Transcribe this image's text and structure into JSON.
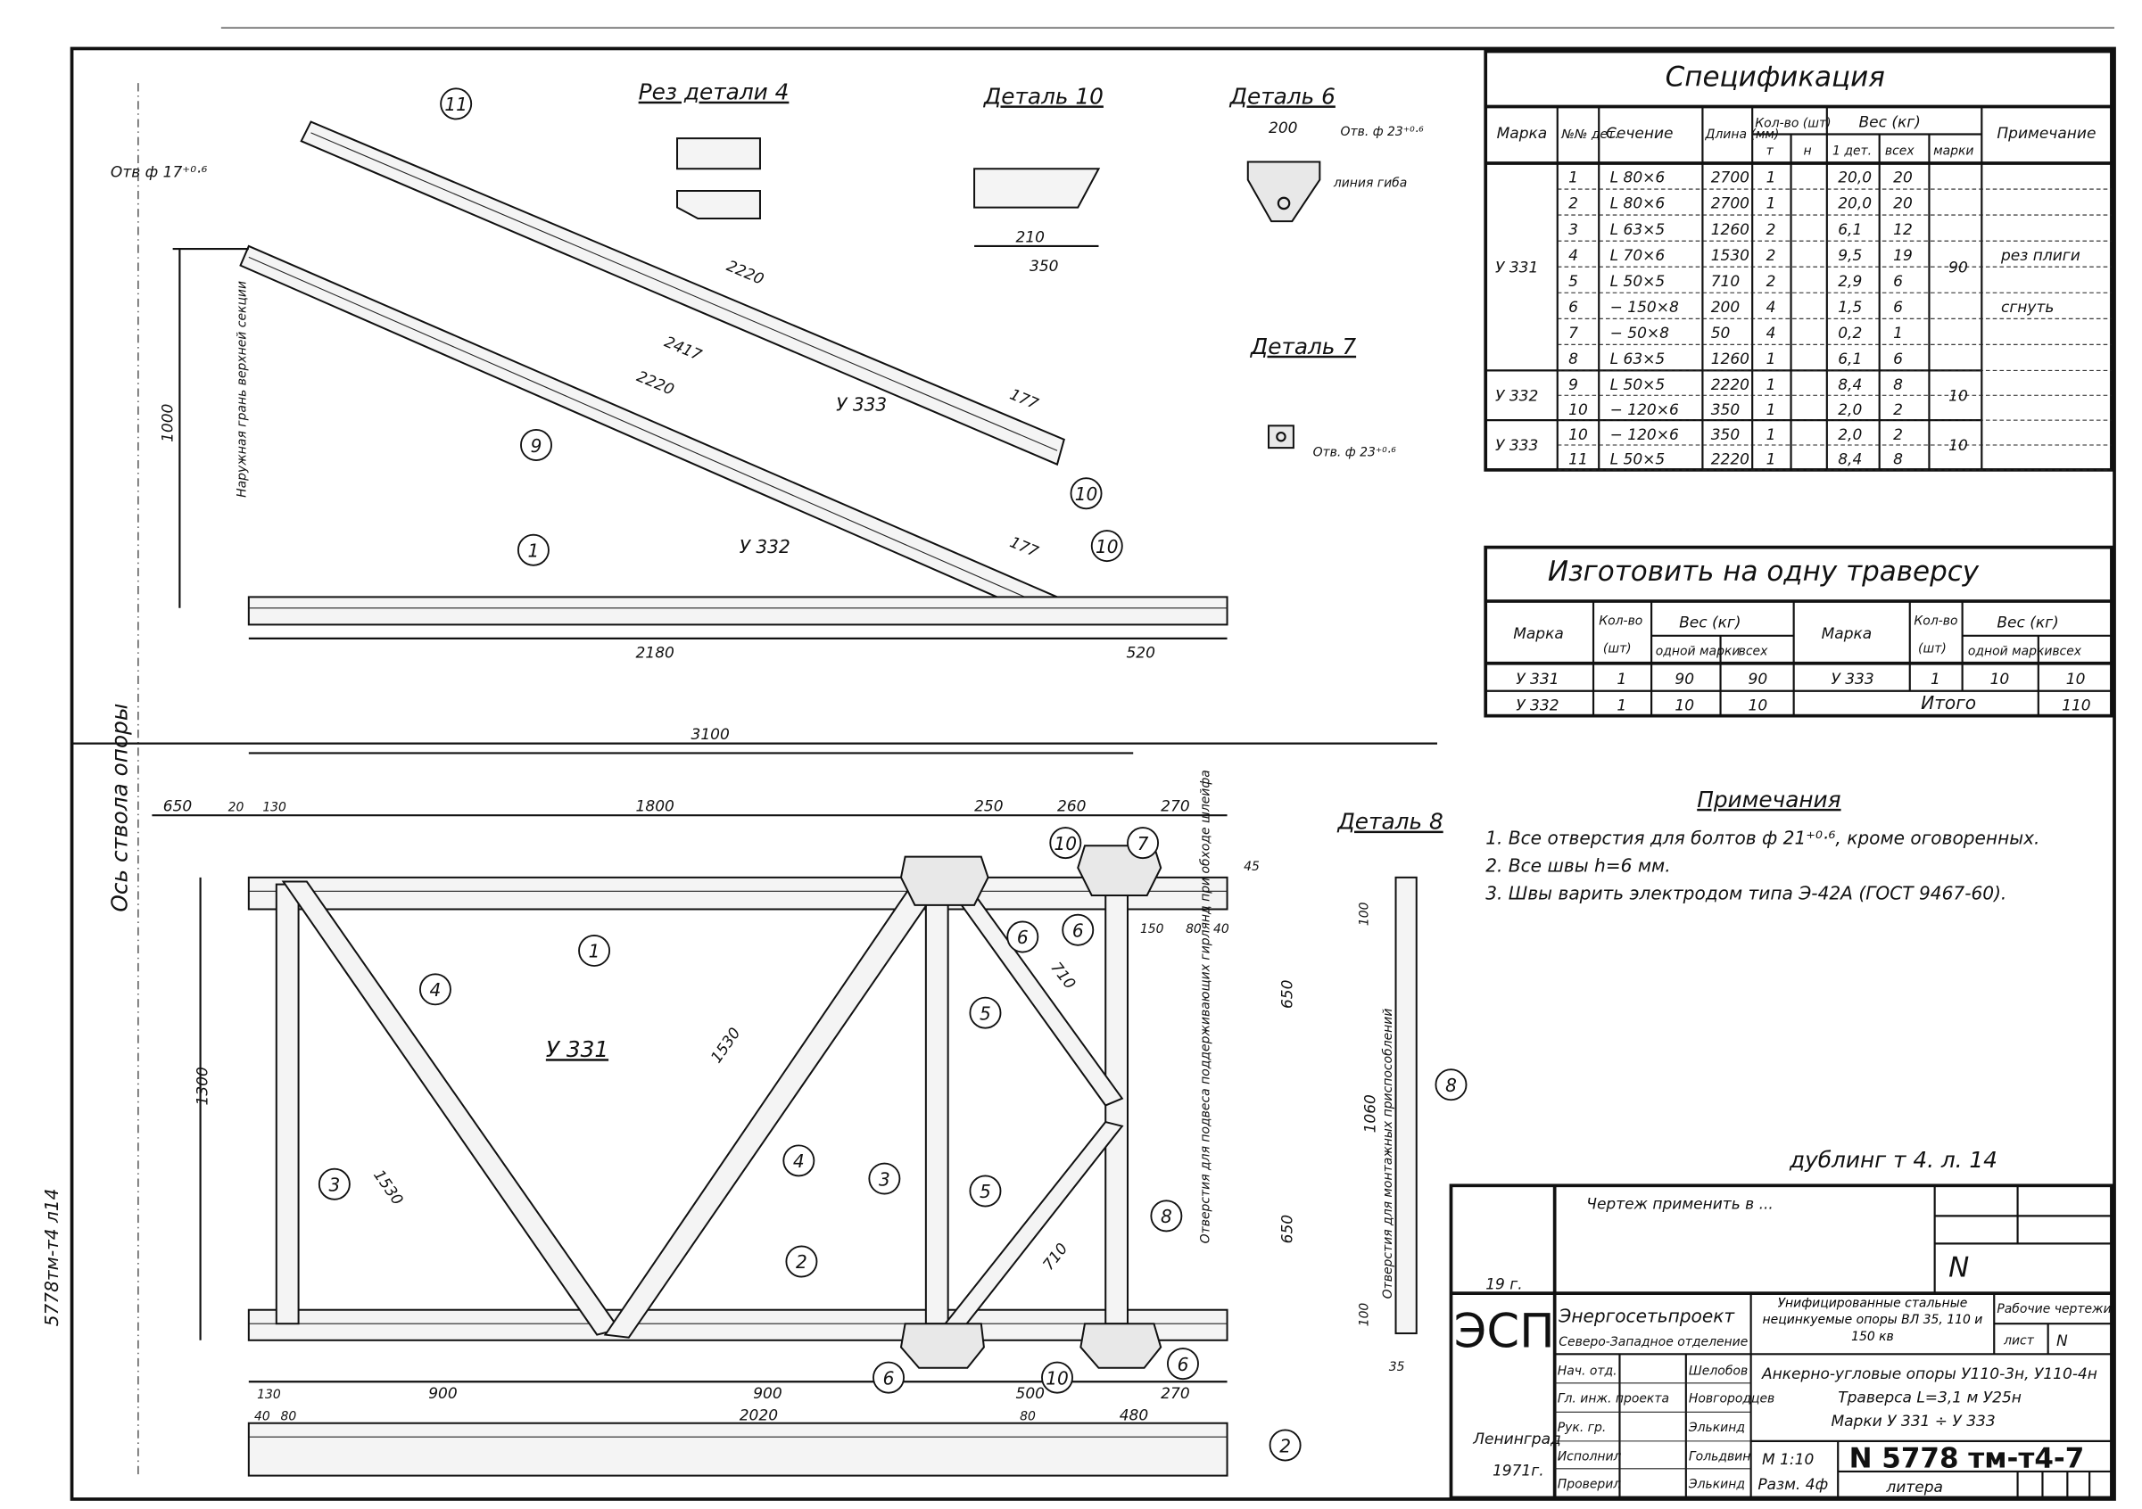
{
  "spec": {
    "title": "Спецификация",
    "headers": {
      "mark": "Марка",
      "part_no": "№№ дет.",
      "section": "Сечение",
      "length": "Длина (мм)",
      "qty": "Кол-во (шт)",
      "qty_t": "т",
      "qty_n": "н",
      "weight": "Вес (кг)",
      "w_part": "1 дет.",
      "w_all": "всех",
      "w_mark": "марки",
      "note": "Примечание"
    },
    "groups": [
      {
        "mark": "У 331",
        "mark_weight": "90",
        "rows": [
          {
            "no": "1",
            "section": "L 80×6",
            "length": "2700",
            "qty": "1",
            "w1": "20,0",
            "wall": "20"
          },
          {
            "no": "2",
            "section": "L 80×6",
            "length": "2700",
            "qty": "1",
            "w1": "20,0",
            "wall": "20"
          },
          {
            "no": "3",
            "section": "L 63×5",
            "length": "1260",
            "qty": "2",
            "w1": "6,1",
            "wall": "12"
          },
          {
            "no": "4",
            "section": "L 70×6",
            "length": "1530",
            "qty": "2",
            "w1": "9,5",
            "wall": "19",
            "note": "рез плиги"
          },
          {
            "no": "5",
            "section": "L 50×5",
            "length": "710",
            "qty": "2",
            "w1": "2,9",
            "wall": "6"
          },
          {
            "no": "6",
            "section": "− 150×8",
            "length": "200",
            "qty": "4",
            "w1": "1,5",
            "wall": "6",
            "note": "сгнуть"
          },
          {
            "no": "7",
            "section": "− 50×8",
            "length": "50",
            "qty": "4",
            "w1": "0,2",
            "wall": "1"
          },
          {
            "no": "8",
            "section": "L 63×5",
            "length": "1260",
            "qty": "1",
            "w1": "6,1",
            "wall": "6"
          }
        ]
      },
      {
        "mark": "У 332",
        "mark_weight": "10",
        "rows": [
          {
            "no": "9",
            "section": "L 50×5",
            "length": "2220",
            "qty": "1",
            "w1": "8,4",
            "wall": "8"
          },
          {
            "no": "10",
            "section": "− 120×6",
            "length": "350",
            "qty": "1",
            "w1": "2,0",
            "wall": "2"
          }
        ]
      },
      {
        "mark": "У 333",
        "mark_weight": "10",
        "rows": [
          {
            "no": "10",
            "section": "− 120×6",
            "length": "350",
            "qty": "1",
            "w1": "2,0",
            "wall": "2"
          },
          {
            "no": "11",
            "section": "L 50×5",
            "length": "2220",
            "qty": "1",
            "w1": "8,4",
            "wall": "8"
          }
        ]
      }
    ]
  },
  "make": {
    "title": "Изготовить на одну траверсу",
    "headers": {
      "mark": "Марка",
      "qty": "Кол-во",
      "qty_unit": "(шт)",
      "weight": "Вес (кг)",
      "one": "одной марки",
      "all": "всех"
    },
    "rows": [
      {
        "mark": "У 331",
        "qty": "1",
        "one": "90",
        "all": "90"
      },
      {
        "mark": "У 332",
        "qty": "1",
        "one": "10",
        "all": "10"
      },
      {
        "mark": "У 333",
        "qty": "1",
        "one": "10",
        "all": "10"
      }
    ],
    "total_label": "Итого",
    "total": "110"
  },
  "notes": {
    "title": "Примечания",
    "items": [
      "1. Все отверстия для болтов ф 21⁺⁰·⁶, кроме оговоренных.",
      "2. Все швы h=6 мм.",
      "3. Швы варить электродом типа Э-42А (ГОСТ 9467-60)."
    ]
  },
  "views": {
    "cut4": "Рез детали 4",
    "det10": "Деталь 10",
    "det6": "Деталь 6",
    "det7": "Деталь 7",
    "det8": "Деталь 8",
    "u331": "У 331",
    "u332": "У 332",
    "u333": "У 333",
    "hole17": "Отв ф 17⁺⁰·⁶",
    "hole23a": "Отв. ф 23⁺⁰·⁶",
    "hole23b": "Отв. ф 23⁺⁰·⁶",
    "bend_line": "линия гиба",
    "axis": "Ось ствола опоры",
    "outer_face": "Наружная грань верхней секции",
    "holes_wire": "Отверстия для подвеса поддерживающих гирлянд при обходе шлейфа",
    "holes_fixture": "Отверстия для монтажных приспособлений",
    "sign": "дублинг т 4. л. 14"
  },
  "parts": [
    "1",
    "2",
    "3",
    "4",
    "5",
    "6",
    "7",
    "8",
    "9",
    "10",
    "11"
  ],
  "dims": {
    "d2220a": "2220",
    "d2417": "2417",
    "d2220b": "2220",
    "d1000": "1000",
    "d2180": "2180",
    "d520": "520",
    "d177a": "177",
    "d177b": "177",
    "d3100": "3100",
    "d650": "650",
    "d20": "20",
    "d130": "130",
    "d1800": "1800",
    "d250": "250",
    "d260": "260",
    "d270": "270",
    "d1300": "1300",
    "d1530": "1530",
    "d1530b": "1530",
    "d900a": "900",
    "d900b": "900",
    "d500": "500",
    "d2020": "2020",
    "d480": "480",
    "d80": "80",
    "d650r": "650",
    "d650r2": "650",
    "d1060": "1060",
    "d100": "100",
    "d100b": "100",
    "d35": "35",
    "d150": "150",
    "d80b": "80",
    "d40": "40",
    "d210": "210",
    "d350": "350",
    "d200": "200",
    "d45": "45",
    "d710": "710",
    "d710b": "710"
  },
  "title_block": {
    "apply": "Чертеж применить в ...",
    "year_blank": "19   г.",
    "num_n": "N",
    "logo": "ЭСП",
    "org": "Энергосетьпроект",
    "org_sub": "Северо-Западное отделение",
    "project": "Унифицированные стальные нецинкуемые опоры ВЛ 35, 110 и 150 кв",
    "work": "Рабочие чертежи",
    "sheet_label": "лист",
    "sheet": "N",
    "roles": [
      {
        "role": "Нач. отд.",
        "name": "Шелобов"
      },
      {
        "role": "Гл. инж. проекта",
        "name": "Новгородцев"
      },
      {
        "role": "Рук. гр.",
        "name": "Элькинд"
      },
      {
        "role": "Исполнил",
        "name": "Гольдвин"
      },
      {
        "role": "Проверил",
        "name": "Элькинд"
      }
    ],
    "subject1": "Анкерно-угловые опоры У110-3н, У110-4н",
    "subject2": "Траверса L=3,1 м  У25н",
    "subject3": "Марки  У 331 ÷ У 333",
    "scale": "М 1:10",
    "size": "Разм. 4ф",
    "drawing_no": "N 5778 тм-т4-7",
    "litera": "литера",
    "city": "Ленинград",
    "year": "1971г.",
    "side_code": "5778тм-т4 л14"
  }
}
